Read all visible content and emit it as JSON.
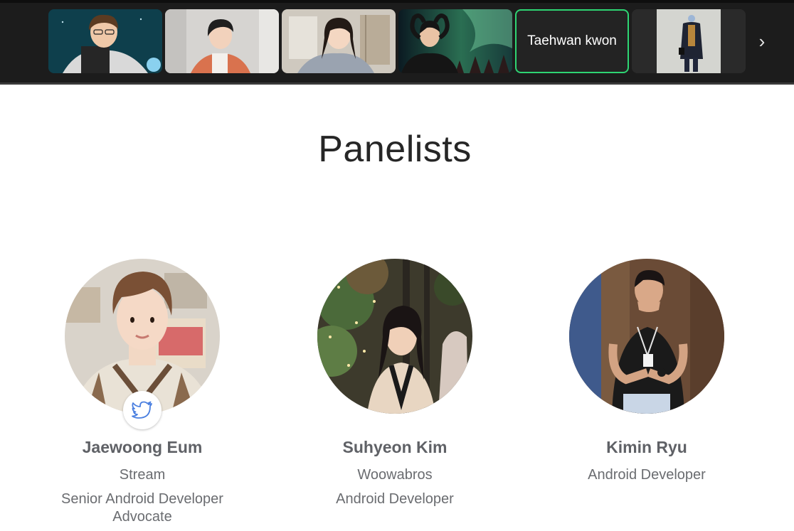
{
  "video_strip": {
    "participants": [
      {
        "name": "participant-1",
        "has_video": true
      },
      {
        "name": "participant-2",
        "has_video": true
      },
      {
        "name": "participant-3",
        "has_video": true
      },
      {
        "name": "participant-4",
        "has_video": true
      },
      {
        "label": "Taehwan kwon",
        "has_video": false,
        "active_speaker": true
      },
      {
        "name": "participant-6",
        "has_video": true
      }
    ],
    "next_icon": "chevron-right-icon",
    "active_border_color": "#2ed573"
  },
  "page": {
    "title": "Panelists"
  },
  "panelists": [
    {
      "name": "Jaewoong Eum",
      "company": "Stream",
      "role": "Senior Android Developer Advocate",
      "social_icon": "twitter-icon"
    },
    {
      "name": "Suhyeon Kim",
      "company": "Woowabros",
      "role": "Android Developer"
    },
    {
      "name": "Kimin Ryu",
      "role": "Android Developer"
    }
  ]
}
